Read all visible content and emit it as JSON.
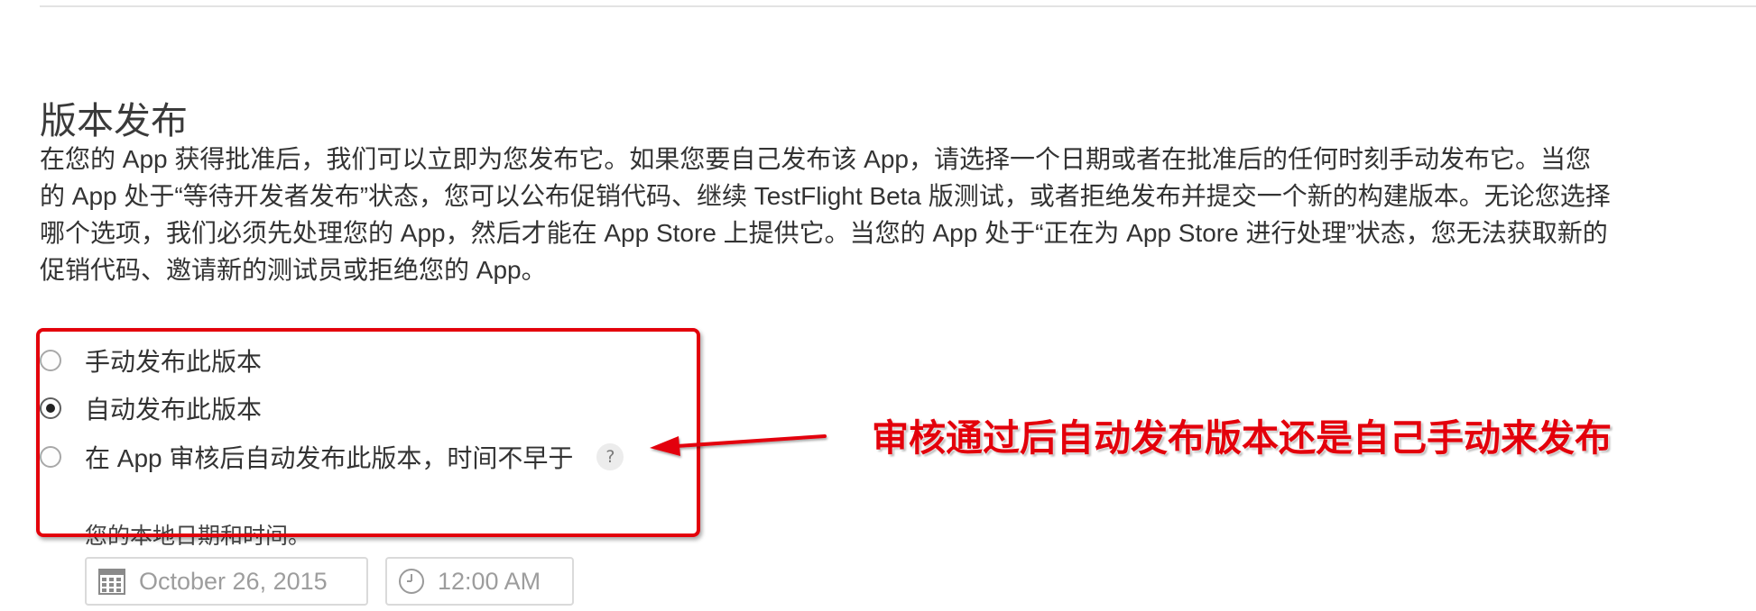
{
  "section": {
    "title": "版本发布",
    "description_lines": [
      "在您的 App 获得批准后，我们可以立即为您发布它。如果您要自己发布该 App，请选择一个日期或者在批准后的任何时刻手动发布它。当您",
      "的 App 处于“等待开发者发布”状态，您可以公布促销代码、继续 TestFlight Beta 版测试，或者拒绝发布并提交一个新的构建版本。无论您选择",
      "哪个选项，我们必须先处理您的 App，然后才能在 App Store 上提供它。当您的 App 处于“正在为 App Store 进行处理”状态，您无法获取新的",
      "促销代码、邀请新的测试员或拒绝您的 App。"
    ]
  },
  "release_options": [
    {
      "label": "手动发布此版本",
      "selected": false
    },
    {
      "label": "自动发布此版本",
      "selected": true
    },
    {
      "label": "在 App 审核后自动发布此版本，时间不早于",
      "selected": false,
      "help": "?"
    }
  ],
  "scheduled": {
    "timezone_note": "您的本地日期和时间。",
    "date_value": "October 26, 2015",
    "time_value": "12:00 AM"
  },
  "annotation": {
    "text": "审核通过后自动发布版本还是自己手动来发布",
    "color": "#e3000b"
  },
  "icons": {
    "calendar": "calendar-icon",
    "clock": "clock-icon",
    "help": "help-icon"
  }
}
